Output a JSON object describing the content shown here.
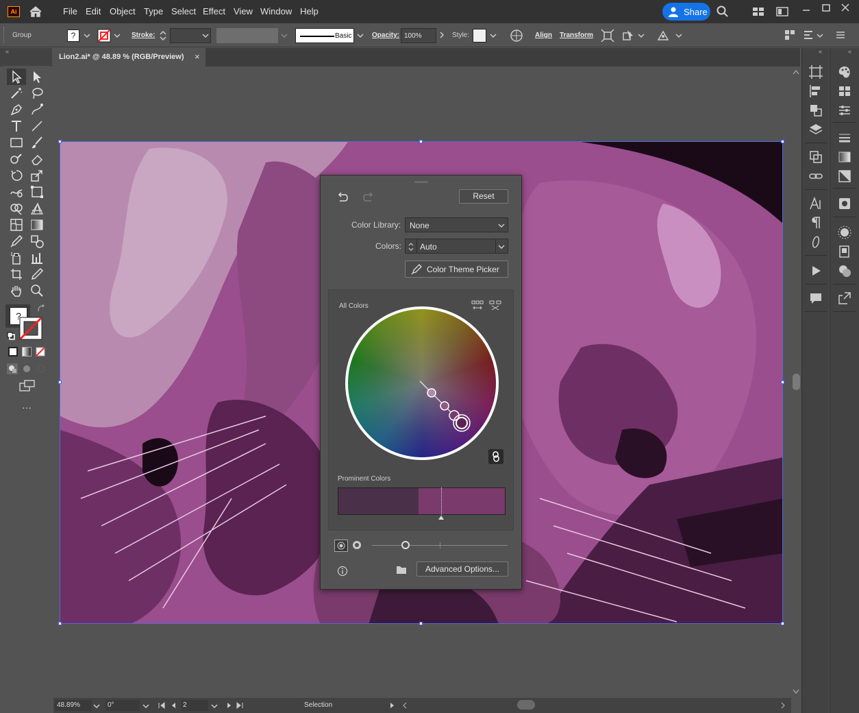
{
  "menubar": {
    "app_logo": "Ai",
    "items": [
      "File",
      "Edit",
      "Object",
      "Type",
      "Select",
      "Effect",
      "View",
      "Window",
      "Help"
    ],
    "share_label": "Share"
  },
  "control": {
    "selection_type": "Group",
    "fill_unknown": "?",
    "stroke_label": "Stroke:",
    "stroke_profile": "Basic",
    "opacity_label": "Opacity:",
    "opacity_value": "100%",
    "style_label": "Style:",
    "align_label": "Align",
    "transform_label": "Transform"
  },
  "tab": {
    "title": "Lion2.ai* @ 48.89 % (RGB/Preview)",
    "close": "×"
  },
  "tools": {
    "fill_unknown": "?",
    "more": "···"
  },
  "recolor": {
    "reset_label": "Reset",
    "color_library_label": "Color Library:",
    "color_library_value": "None",
    "colors_label": "Colors:",
    "colors_value": "Auto",
    "theme_picker_label": "Color Theme Picker",
    "all_colors_label": "All Colors",
    "prominent_label": "Prominent Colors",
    "prominent_colors": [
      {
        "color": "#4a3048",
        "share": 0.48
      },
      {
        "color": "#7a3a6c",
        "share": 0.52
      }
    ],
    "advanced_label": "Advanced Options..."
  },
  "status": {
    "zoom": "48.89%",
    "rotation": "0°",
    "artboard": "2",
    "tool": "Selection"
  },
  "colors": {
    "accent": "#1473e6",
    "art_base": "#9a4e8d",
    "art_light": "#c98fc0",
    "art_dark": "#3d1a39"
  }
}
